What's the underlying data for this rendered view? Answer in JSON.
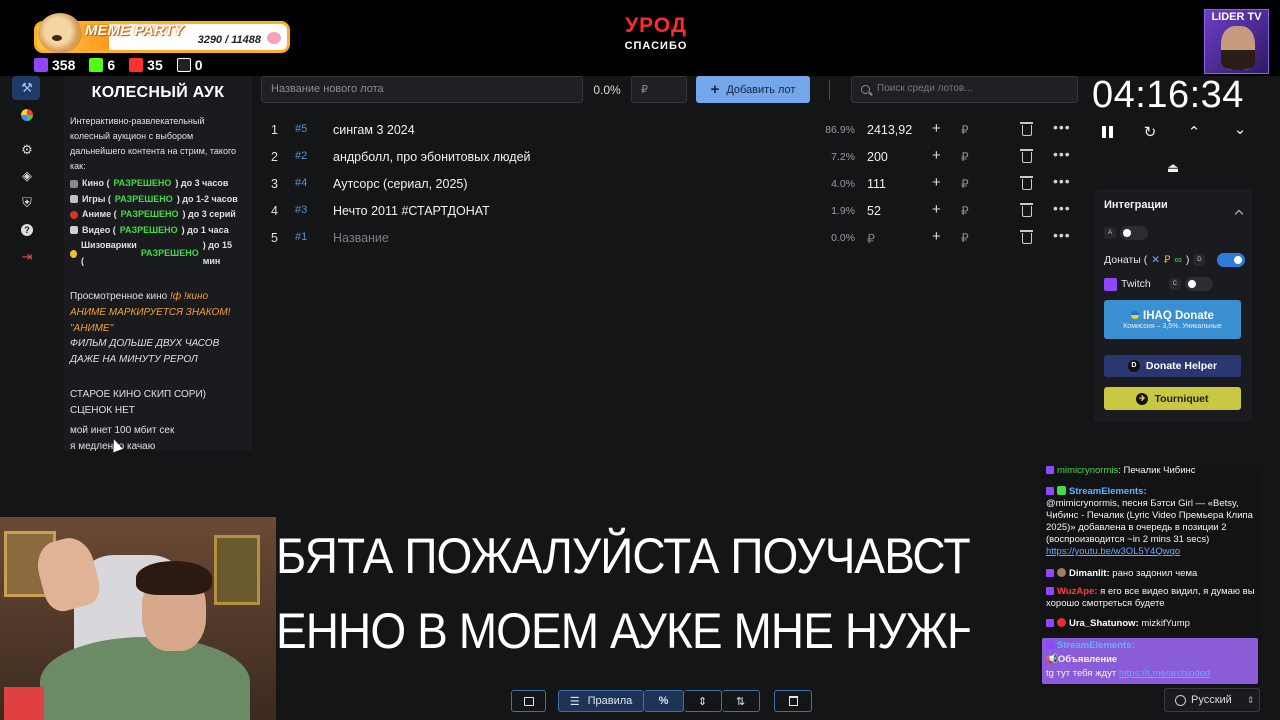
{
  "overlay": {
    "meme_title": "MEME PARTY",
    "meme_count": "3290 / 11488",
    "meme_progress": 0.286,
    "stats": [
      {
        "icon": "twitch-icon",
        "value": "358",
        "color": "#9146ff"
      },
      {
        "icon": "kick-icon",
        "value": "6",
        "color": "#53fc18"
      },
      {
        "icon": "live-icon",
        "value": "35",
        "color": "#ff3030"
      },
      {
        "icon": "w-icon",
        "value": "0",
        "color": "#ffffff"
      }
    ],
    "center_title": "УРОД",
    "center_sub": "СПАСИБО",
    "lider": "LIDER TV"
  },
  "description": {
    "title": "КОЛЕСНЫЙ АУК",
    "intro": "Интерактивно-развлекательный колесный аукцион с выбором дальнейшего контента на стрим, такого как:",
    "rules": [
      {
        "pre": "Кино (",
        "ok": "РАЗРЕШЕНО",
        "post": ") до 3 часов",
        "color": "#8a8a8a"
      },
      {
        "pre": "Игры (",
        "ok": "РАЗРЕШЕНО",
        "post": ") до 1-2 часов",
        "color": "#c0c0c0"
      },
      {
        "pre": "Аниме (",
        "ok": "РАЗРЕШЕНО",
        "post": ") до 3 серий",
        "color": "#e03030"
      },
      {
        "pre": "Видео (",
        "ok": "РАЗРЕШЕНО",
        "post": ") до 1 часа",
        "color": "#d0d0d0"
      },
      {
        "pre": "Шизоварики (",
        "ok": "РАЗРЕШЕНО",
        "post": ") до 15 мин",
        "color": "#f2c030"
      }
    ],
    "watched_label": "Просмотренное кино",
    "watched_cmds": "!ф !кино",
    "anime_note": "АНИМЕ МАРКИРУЕТСЯ ЗНАКОМ! \"АНИМЕ\"",
    "film_note": "ФИЛЬМ ДОЛЬШЕ ДВУХ ЧАСОВ ДАЖЕ НА МИНУТУ РЕРОЛ",
    "old_note": "СТАРОЕ КИНО СКИП СОРИ) СЦЕНОК НЕТ",
    "inet_note": "мой инет 100 мбит сек",
    "inet_note2": "я медленно качаю"
  },
  "controls": {
    "name_placeholder": "Название нового лота",
    "pct": "0.0%",
    "amount_placeholder": "₽",
    "add_label": "Добавить лот",
    "search_placeholder": "Поиск среди лотов..."
  },
  "lots": [
    {
      "idx": "1",
      "hash": "#5",
      "name": "сингам 3 2024",
      "pct": "86.9%",
      "amount": "2413,92",
      "rub": "₽"
    },
    {
      "idx": "2",
      "hash": "#2",
      "name": "андрболл, про эбонитовых людей",
      "pct": "7.2%",
      "amount": "200",
      "rub": "₽"
    },
    {
      "idx": "3",
      "hash": "#4",
      "name": "Аутсорс (сериал, 2025)",
      "pct": "4.0%",
      "amount": "111",
      "rub": "₽"
    },
    {
      "idx": "4",
      "hash": "#3",
      "name": "Нечто 2011 #СТАРТДОНАТ",
      "pct": "1.9%",
      "amount": "52",
      "rub": "₽"
    },
    {
      "idx": "5",
      "hash": "#1",
      "name": "Название",
      "pct": "0.0%",
      "amount": "₽",
      "rub": "₽"
    }
  ],
  "timer": {
    "value": "04:16:34"
  },
  "integrations": {
    "title": "Интеграции",
    "key_a": "A",
    "donations_label": "Донаты (",
    "key_d": "D",
    "twitch_label": "Twitch",
    "key_c": "C",
    "ihaq_title": "IHAQ Donate",
    "ihaq_sub": "Комиссия – 3,5%. Уникальные",
    "donate_helper": "Donate Helper",
    "tourniquet": "Tourniquet"
  },
  "chat": {
    "m0_name": "mimicrynormis",
    "m0_text": ": Печалик Чибинс",
    "m1_name": "StreamElements:",
    "m1_text": "@mimicrynormis, песня Бэтси Girl — «Betsy, Чибинс - Печалик (Lyric Video Премьера Клипа 2025)» добавлена в очередь в позиции 2 (воспроизводится ~in 2 mins 31 secs)",
    "m1_link": "https://youtu.be/w3OL5Y4Qwqo",
    "m2_name": "Dimanlit:",
    "m2_text": " рано задонил чема",
    "m3_name": "WuzApe:",
    "m3_text": " я его все видео видил, я думаю вы хорошо смотреться будете",
    "m4_name": "Ura_Shatunow:",
    "m4_text": " mizkifYump",
    "m5_name": "StreamElements:",
    "m5_announce": "Объявление",
    "m5_text": "tg тут тебя ждут",
    "m5_link": "https://t.me/archiodod"
  },
  "ticker": {
    "line1": "БЯТА ПОЖАЛУЙСТА ПОУЧАВСТВУЙТЕ РЕБ",
    "line2": "ЕННО В МОЕМ АУКЕ МНЕ НУЖНЕЕ       ИМ"
  },
  "toolbar": {
    "rules_label": "Правила",
    "pct_label": "%"
  },
  "lang": {
    "label": "Русский"
  }
}
